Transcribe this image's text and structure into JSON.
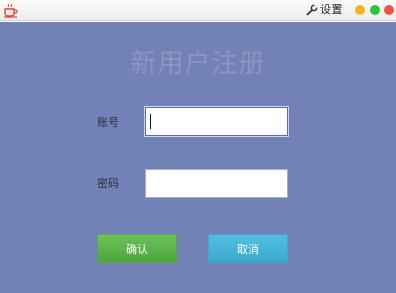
{
  "titlebar": {
    "app_icon": "teacup-icon",
    "settings_icon": "wrench-icon",
    "settings_label": "设置",
    "controls": {
      "minimize_color": "#f4b41c",
      "maximize_color": "#2dc23b",
      "close_color": "#f05245"
    }
  },
  "form": {
    "title": "新用户注册",
    "account_label": "账号",
    "account_value": "",
    "password_label": "密码",
    "password_value": "",
    "confirm_label": "确认",
    "cancel_label": "取消"
  },
  "colors": {
    "background": "#7282b6",
    "confirm_button": "#5cb54b",
    "cancel_button": "#46b3d8"
  }
}
